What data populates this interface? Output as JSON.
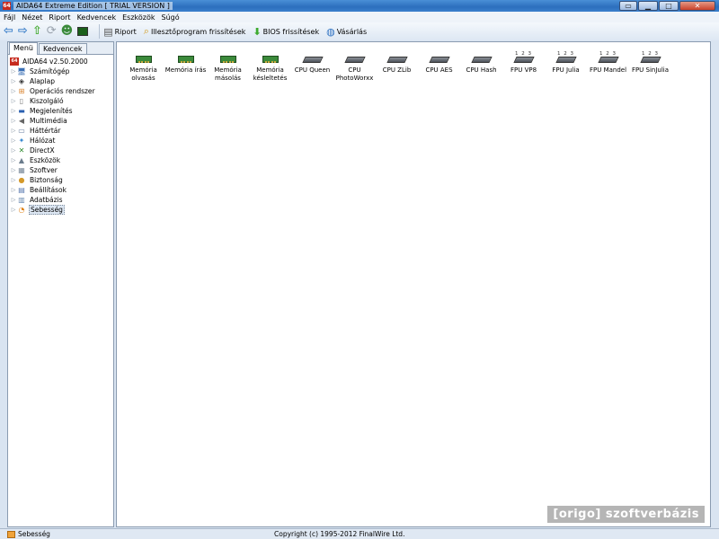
{
  "window": {
    "title": "AIDA64 Extreme Edition  [ TRIAL VERSION ]",
    "app_icon_text": "64"
  },
  "menubar": [
    "Fájl",
    "Nézet",
    "Riport",
    "Kedvencek",
    "Eszközök",
    "Súgó"
  ],
  "toolbar": {
    "report_label": "Riport",
    "driver_updates_label": "Illesztőprogram frissítések",
    "bios_updates_label": "BIOS frissítések",
    "buy_label": "Vásárlás"
  },
  "left_panel": {
    "tabs": [
      "Menü",
      "Kedvencek"
    ],
    "root": "AIDA64 v2.50.2000",
    "items": [
      {
        "label": "Számítógép",
        "icon": "computer-icon"
      },
      {
        "label": "Alaplap",
        "icon": "motherboard-icon"
      },
      {
        "label": "Operációs rendszer",
        "icon": "windows-icon"
      },
      {
        "label": "Kiszolgáló",
        "icon": "server-icon"
      },
      {
        "label": "Megjelenítés",
        "icon": "display-icon"
      },
      {
        "label": "Multimédia",
        "icon": "speaker-icon"
      },
      {
        "label": "Háttértár",
        "icon": "storage-icon"
      },
      {
        "label": "Hálózat",
        "icon": "network-icon"
      },
      {
        "label": "DirectX",
        "icon": "directx-icon"
      },
      {
        "label": "Eszközök",
        "icon": "devices-icon"
      },
      {
        "label": "Szoftver",
        "icon": "software-icon"
      },
      {
        "label": "Biztonság",
        "icon": "security-icon"
      },
      {
        "label": "Beállítások",
        "icon": "settings-icon"
      },
      {
        "label": "Adatbázis",
        "icon": "database-icon"
      },
      {
        "label": "Sebesség",
        "icon": "benchmark-icon",
        "selected": true
      }
    ]
  },
  "benchmarks": [
    {
      "label": "Memória olvasás",
      "type": "memory"
    },
    {
      "label": "Memória írás",
      "type": "memory"
    },
    {
      "label": "Memória másolás",
      "type": "memory"
    },
    {
      "label": "Memória késleltetés",
      "type": "memory"
    },
    {
      "label": "CPU Queen",
      "type": "cpu"
    },
    {
      "label": "CPU PhotoWorxx",
      "type": "cpu"
    },
    {
      "label": "CPU ZLib",
      "type": "cpu"
    },
    {
      "label": "CPU AES",
      "type": "cpu"
    },
    {
      "label": "CPU Hash",
      "type": "cpu"
    },
    {
      "label": "FPU VP8",
      "type": "fpu"
    },
    {
      "label": "FPU Julia",
      "type": "fpu"
    },
    {
      "label": "FPU Mandel",
      "type": "fpu"
    },
    {
      "label": "FPU SinJulia",
      "type": "fpu"
    }
  ],
  "fpu_digits": "1 2 3",
  "watermark": "[origo] szoftverbázis",
  "statusbar": {
    "left": "Sebesség",
    "center": "Copyright (c) 1995-2012 FinalWire Ltd."
  }
}
